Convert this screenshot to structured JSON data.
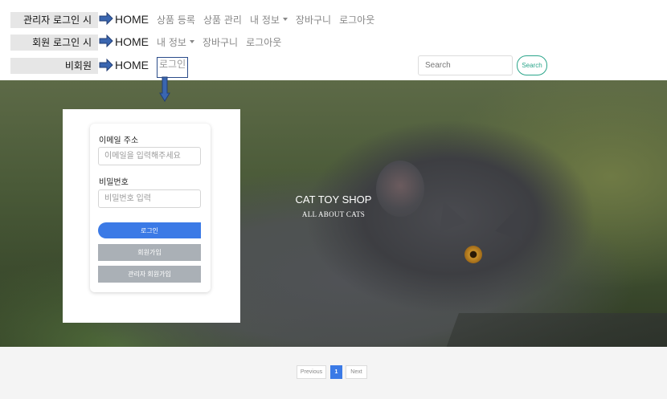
{
  "rows": [
    {
      "label": "관리자 로그인 시",
      "home": "HOME",
      "items": [
        "상품 등록",
        "상품 관리",
        "내 정보",
        "장바구니",
        "로그아웃"
      ]
    },
    {
      "label": "회원 로그인 시",
      "home": "HOME",
      "items": [
        "내 정보",
        "장바구니",
        "로그아웃"
      ]
    },
    {
      "label": "비회원",
      "home": "HOME",
      "items": [
        "로그인"
      ]
    }
  ],
  "search": {
    "placeholder": "Search",
    "button": "Search"
  },
  "hero": {
    "title": "CAT TOY SHOP",
    "subtitle": "ALL ABOUT CATS"
  },
  "login_form": {
    "email_label": "이메일 주소",
    "email_placeholder": "이메일을 입력해주세요",
    "password_label": "비밀번호",
    "password_placeholder": "비밀번호 입력",
    "login_button": "로그인",
    "signup_button": "회원가입",
    "admin_signup_button": "관리자 회원가입"
  },
  "pagination": {
    "previous": "Previous",
    "current": "1",
    "next": "Next"
  },
  "colors": {
    "primary": "#3b7ae6",
    "search_accent": "#2aa58a",
    "arrow": "#3a66b0",
    "gray_button": "#aab0b6"
  }
}
